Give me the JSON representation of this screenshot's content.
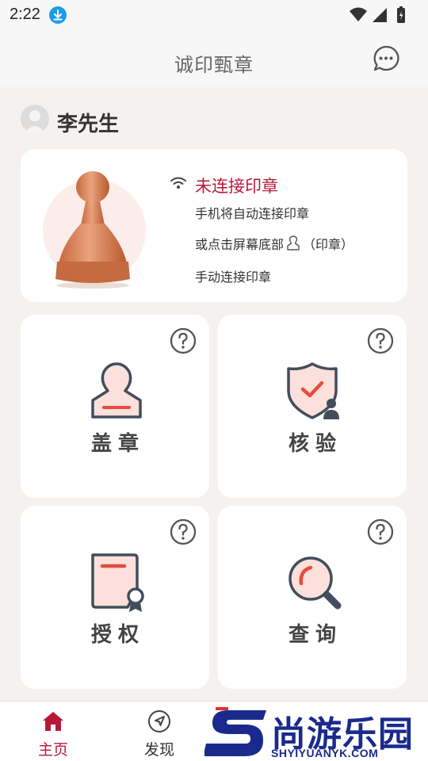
{
  "status_bar": {
    "time": "2:22"
  },
  "app_bar": {
    "title": "诚印甄章"
  },
  "user": {
    "name": "李先生"
  },
  "connection": {
    "status": "未连接印章",
    "line1": "手机将自动连接印章",
    "line2_before": "或点击屏幕底部",
    "line2_after": "（印章）",
    "line3": "手动连接印章"
  },
  "tiles": [
    {
      "label": "盖章",
      "icon": "stamp-person-icon"
    },
    {
      "label": "核验",
      "icon": "shield-check-icon"
    },
    {
      "label": "授权",
      "icon": "certificate-badge-icon"
    },
    {
      "label": "查询",
      "icon": "magnifier-icon"
    }
  ],
  "tabs": [
    {
      "label": "主页",
      "icon": "home-icon",
      "active": true
    },
    {
      "label": "发现",
      "icon": "compass-icon",
      "active": false
    }
  ],
  "watermark": {
    "cn": "尚游乐园",
    "en": "SHYIYUANYK.COM"
  },
  "colors": {
    "accent": "#b8193a",
    "background": "#f5f1ee",
    "watermark_blue": "#1a2a8c"
  }
}
